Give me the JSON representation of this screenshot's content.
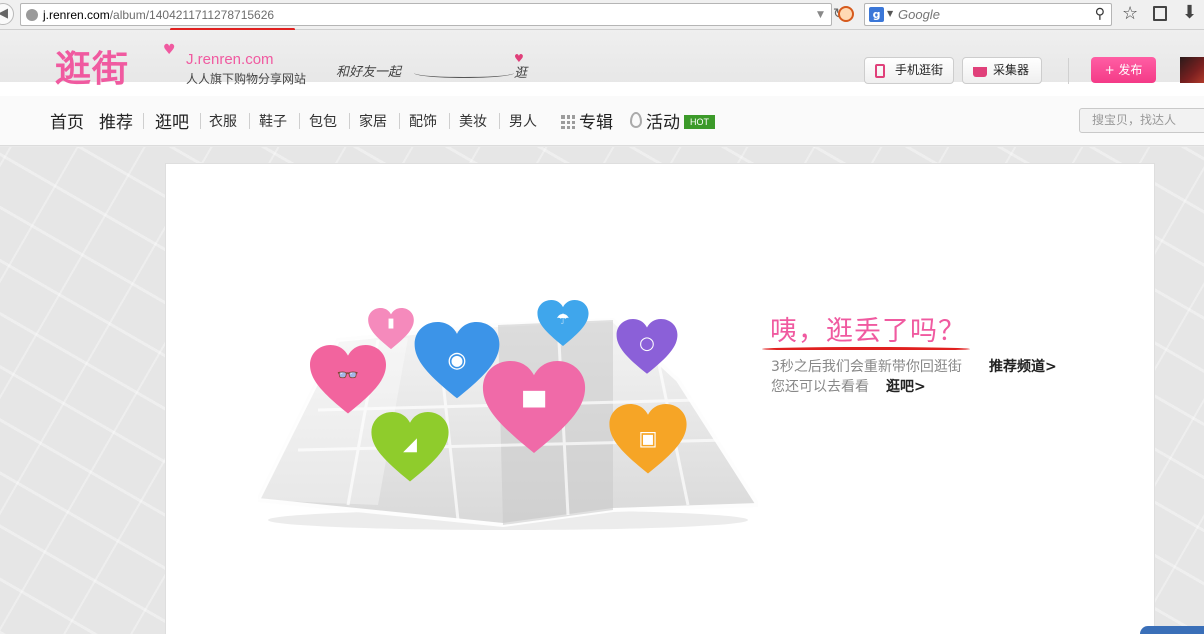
{
  "browser": {
    "url_host": "j.renren.com",
    "url_path": "/album/1404211711278715626",
    "search_placeholder": "Google",
    "search_engine_icon": "google-g-icon"
  },
  "header": {
    "logo_text": "逛街",
    "logo_domain": "J.renren.com",
    "logo_tagline": "人人旗下购物分享网站",
    "slogan": "和好友一起",
    "slogan_end": "逛",
    "mobile_button": "手机逛街",
    "collect_button": "采集器",
    "publish_button": "+ 发布"
  },
  "nav": {
    "home": "首页",
    "recommend": "推荐",
    "stroll": "逛吧",
    "clothes": "衣服",
    "shoes": "鞋子",
    "bags": "包包",
    "home_goods": "家居",
    "accessories": "配饰",
    "beauty": "美妆",
    "men": "男人",
    "albums": "专辑",
    "events": "活动",
    "hot_badge": "HOT",
    "search_placeholder": "搜宝贝，找达人"
  },
  "message": {
    "title": "咦，逛丢了吗？",
    "line1": "3秒之后我们会重新带你回逛街",
    "line1_link": "推荐频道>",
    "line2": "您还可以去看看",
    "line2_link": "逛吧>"
  },
  "colors": {
    "brand_pink": "#f05aa0",
    "annotation_red": "#e0201f",
    "hot_green": "#3c9a2a"
  },
  "illustration_hearts": [
    {
      "name": "sunglasses-heart",
      "color": "#f2649e",
      "icon": "sunglasses-icon"
    },
    {
      "name": "lipstick-heart",
      "color": "#f58abc",
      "icon": "lipstick-icon"
    },
    {
      "name": "camera-heart",
      "color": "#3c94e8",
      "icon": "camera-icon"
    },
    {
      "name": "umbrella-heart",
      "color": "#3fa6ec",
      "icon": "umbrella-icon"
    },
    {
      "name": "ring-heart",
      "color": "#8b60d8",
      "icon": "ring-icon"
    },
    {
      "name": "tshirt-heart",
      "color": "#f06aa8",
      "icon": "tshirt-icon"
    },
    {
      "name": "high-heel-heart",
      "color": "#8fcc2c",
      "icon": "high-heel-icon"
    },
    {
      "name": "bag-heart",
      "color": "#f6a526",
      "icon": "bag-icon"
    }
  ]
}
